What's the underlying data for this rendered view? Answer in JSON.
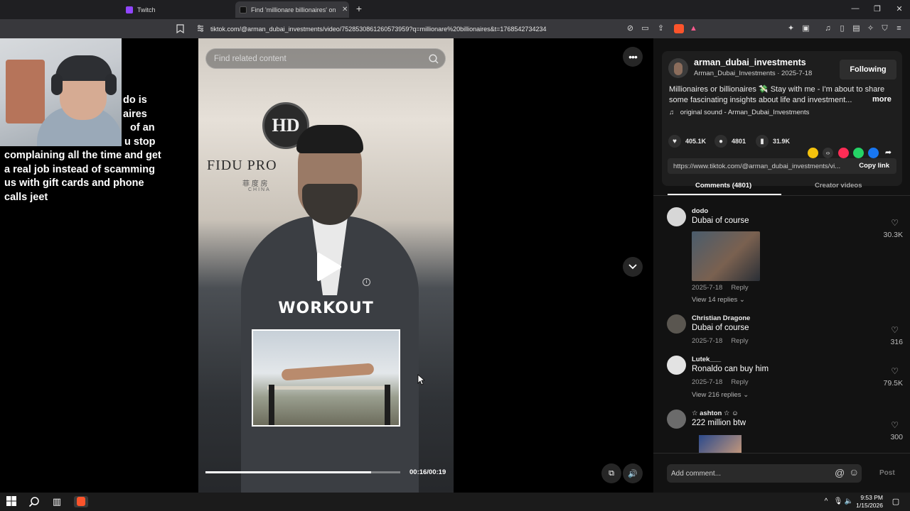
{
  "browser": {
    "tabs": [
      {
        "label": "Twitch",
        "active": false
      },
      {
        "label": "Find 'millionare billionaires' on T",
        "active": true
      }
    ],
    "new_tab": "+",
    "url": "tiktok.com/@arman_dubai_investments/video/7528530861260573959?q=millionare%20billionaires&t=1768542734234",
    "window_controls": [
      "—",
      "❐",
      "✕"
    ]
  },
  "stream_overlay": {
    "text_line1": "do is",
    "text_line2": "aires",
    "text_line3": "of an",
    "text_line4": "u stop",
    "text_rest": "complaining all the time and get a real job instead of scamming us with gift cards and phone calls jeet"
  },
  "video": {
    "search_placeholder": "Find related content",
    "logo_letters": "HD",
    "brand_text": "FIDU PRO",
    "brand_sub": "菲 度 房",
    "brand_sub2": "CHINA",
    "overlay_title": "WORKOUT",
    "progress_fraction": 0.85,
    "time": "00:16/00:19"
  },
  "author": {
    "username": "arman_dubai_investments",
    "display": "Arman_Dubai_Investments · 2025-7-18",
    "follow_label": "Following",
    "description": "Millionaires or billionaires 💸 Stay with me - I'm about to share some fascinating insights about life and investment...",
    "more_label": "more",
    "sound": "original sound - Arman_Dubai_Investments",
    "likes": "405.1K",
    "comments": "4801",
    "saves": "31.9K",
    "link": "https://www.tiktok.com/@arman_dubai_investments/vi...",
    "copy_label": "Copy link"
  },
  "panel_tabs": {
    "comments": "Comments (4801)",
    "creator": "Creator videos"
  },
  "comments": [
    {
      "user": "dodo",
      "text": "Dubai of course",
      "date": "2025-7-18",
      "reply": "Reply",
      "likes": "30.3K",
      "replies": "View 14 replies"
    },
    {
      "user": "Christian Dragone",
      "text": "Dubai of course",
      "date": "2025-7-18",
      "reply": "Reply",
      "likes": "316"
    },
    {
      "user": "Lutek___",
      "text": "Ronaldo can buy him",
      "date": "2025-7-18",
      "reply": "Reply",
      "likes": "79.5K",
      "replies": "View 216 replies"
    },
    {
      "user": "☆ ashton ☆ ☺",
      "text": "222 million btw",
      "likes": "300"
    }
  ],
  "comment_bar": {
    "placeholder": "Add comment...",
    "post_label": "Post"
  },
  "taskbar": {
    "time": "9:53 PM",
    "date": "1/15/2026"
  },
  "colors": {
    "accent_red": "#fe2c55",
    "panel_bg": "#121212",
    "card_bg": "#1e1e1e"
  }
}
